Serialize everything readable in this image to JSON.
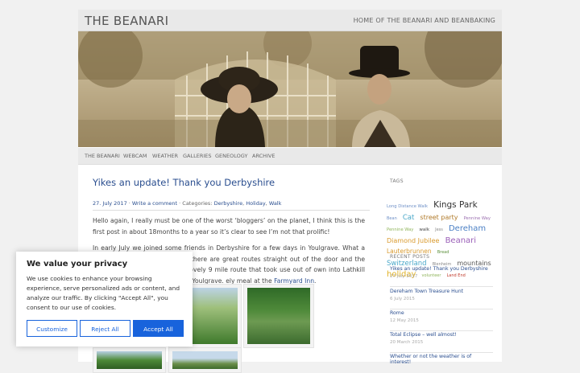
{
  "site": {
    "title": "THE BEANARI",
    "description": "HOME OF THE BEANARI AND BEANBAKING"
  },
  "nav": {
    "items": [
      "THE BEANARI",
      "WEBCAM",
      "WEATHER",
      "GALLERIES",
      "GENEOLOGY",
      "ARCHIVE"
    ]
  },
  "post": {
    "title": "Yikes an update! Thank you Derbyshire",
    "date": "27. July 2017",
    "comment_link": "Write a comment",
    "categories_label": "Categories:",
    "categories": [
      "Derbyshire",
      "Holiday",
      "Walk"
    ],
    "paragraph1": "Hello again,  I really must be one of the worst ‘bloggers’ on the planet, I think this is the first post in about 18months to a year so it’s clear to see I’m not that prolific!",
    "paragraph2_start": "In early July we joined some friends in Derbyshire for a few days in Youlgrave.  What a great base.  If you like walking there are great routes straight out of the door and the Limestone way",
    "paragraph2_frag1": "there we dd a lovely 9 mile route that took use out of",
    "paragraph2_frag2": "own into Lathkill dale and back through Alport to Youlgrave.",
    "paragraph2_frag3": "ely meal at the",
    "inn_link": "Farmyard Inn",
    "paragraph2_end": "."
  },
  "sidebar": {
    "tags_heading": "TAGS",
    "tags": [
      {
        "label": "Long Distance Walk",
        "size": 5.2,
        "color": "#6d8fc7"
      },
      {
        "label": "Kings Park",
        "size": 10.5,
        "color": "#333333"
      },
      {
        "label": "Bean",
        "size": 5,
        "color": "#6d8fc7"
      },
      {
        "label": "Cat",
        "size": 8.5,
        "color": "#4aa8c9"
      },
      {
        "label": "street party",
        "size": 8,
        "color": "#b07a2a"
      },
      {
        "label": "Pennine Way",
        "size": 5.2,
        "color": "#9b6fb0"
      },
      {
        "label": "Pennine Way",
        "size": 5.2,
        "color": "#8fb45a"
      },
      {
        "label": "walk",
        "size": 5.5,
        "color": "#444444"
      },
      {
        "label": "Jess",
        "size": 5,
        "color": "#888888"
      },
      {
        "label": "Dereham",
        "size": 10,
        "color": "#4a7fc4"
      },
      {
        "label": "Diamond Jubilee",
        "size": 8,
        "color": "#d99a2e"
      },
      {
        "label": "Beanari",
        "size": 10,
        "color": "#9a5fb8"
      },
      {
        "label": "Lauterbrunnen",
        "size": 7.5,
        "color": "#d99a2e"
      },
      {
        "label": "Bread",
        "size": 5,
        "color": "#5a8f3a"
      },
      {
        "label": "Switzerland",
        "size": 8.5,
        "color": "#4aa8c9"
      },
      {
        "label": "Blenheim",
        "size": 5,
        "color": "#888888"
      },
      {
        "label": "mountains",
        "size": 8,
        "color": "#555555"
      },
      {
        "label": "holiday",
        "size": 10,
        "color": "#e0b020"
      },
      {
        "label": "volunteer",
        "size": 5,
        "color": "#8fb45a"
      },
      {
        "label": "Land End",
        "size": 5,
        "color": "#c0392b"
      }
    ],
    "recent_heading": "RECENT POSTS",
    "recent": [
      {
        "title": "Yikes an update! Thank you Derbyshire",
        "date": "27 July 2017"
      },
      {
        "title": "Dereham Town Treasure Hunt",
        "date": "6 July 2015"
      },
      {
        "title": "Rome",
        "date": "12 May 2015"
      },
      {
        "title": "Total Eclipse – well almost!",
        "date": "20 March 2015"
      },
      {
        "title": "Whether or not the weather is of interest!",
        "date": ""
      }
    ]
  },
  "cookie": {
    "title": "We value your privacy",
    "text": "We use cookies to enhance your browsing experience, serve personalized ads or content, and analyze our traffic. By clicking \"Accept All\", you consent to our use of cookies.",
    "customize": "Customize",
    "reject": "Reject All",
    "accept": "Accept All"
  },
  "colors": {
    "link": "#2a4e8f",
    "accent": "#1863dc"
  }
}
